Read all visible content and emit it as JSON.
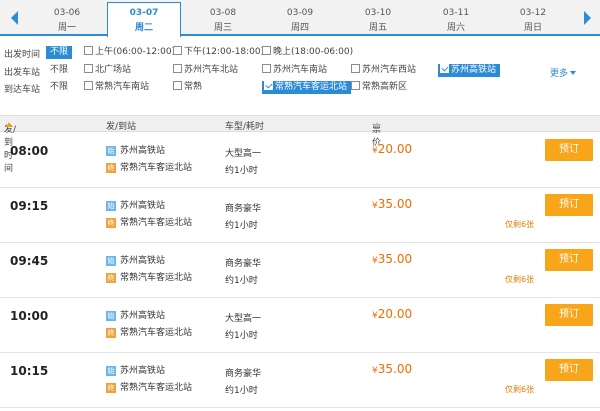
{
  "dates": [
    {
      "date": "03-06",
      "weekday": "周一",
      "active": false
    },
    {
      "date": "03-07",
      "weekday": "周二",
      "active": true
    },
    {
      "date": "03-08",
      "weekday": "周三",
      "active": false
    },
    {
      "date": "03-09",
      "weekday": "周四",
      "active": false
    },
    {
      "date": "03-10",
      "weekday": "周五",
      "active": false
    },
    {
      "date": "03-11",
      "weekday": "周六",
      "active": false
    },
    {
      "date": "03-12",
      "weekday": "周日",
      "active": false
    }
  ],
  "filters": {
    "depart_time": {
      "label": "出发时间",
      "no_limit": "不限",
      "options": [
        "上午(06:00-12:00)",
        "下午(12:00-18:00)",
        "晚上(18:00-06:00)"
      ]
    },
    "depart_station": {
      "label": "出发车站",
      "no_limit": "不限",
      "options": [
        "北广场站",
        "苏州汽车北站",
        "苏州汽车南站",
        "苏州汽车西站",
        "苏州高铁站"
      ],
      "checked": "苏州高铁站"
    },
    "arrive_station": {
      "label": "到达车站",
      "no_limit": "不限",
      "options": [
        "常熟汽车南站",
        "常熟",
        "常熟汽车客运北站",
        "常熟高新区"
      ],
      "checked": "常熟汽车客运北站"
    },
    "more": "更多"
  },
  "table_header": {
    "time": "发/到时间",
    "stations": "发/到站",
    "vehicle": "车型/耗时",
    "price": "票价"
  },
  "icons": {
    "from": "始",
    "to": "终"
  },
  "book_label": "预订",
  "currency": "¥",
  "schedules": [
    {
      "time": "08:00",
      "from": "苏州高铁站",
      "to": "常熟汽车客运北站",
      "vehicle": "大型高一",
      "duration": "约1小时",
      "price": "20.00",
      "remain": ""
    },
    {
      "time": "09:15",
      "from": "苏州高铁站",
      "to": "常熟汽车客运北站",
      "vehicle": "商务豪华",
      "duration": "约1小时",
      "price": "35.00",
      "remain": "仅剩6张"
    },
    {
      "time": "09:45",
      "from": "苏州高铁站",
      "to": "常熟汽车客运北站",
      "vehicle": "商务豪华",
      "duration": "约1小时",
      "price": "35.00",
      "remain": "仅剩6张"
    },
    {
      "time": "10:00",
      "from": "苏州高铁站",
      "to": "常熟汽车客运北站",
      "vehicle": "大型高一",
      "duration": "约1小时",
      "price": "20.00",
      "remain": ""
    },
    {
      "time": "10:15",
      "from": "苏州高铁站",
      "to": "常熟汽车客运北站",
      "vehicle": "商务豪华",
      "duration": "约1小时",
      "price": "35.00",
      "remain": "仅剩6张"
    }
  ],
  "colors": {
    "accent": "#2b8bd6",
    "price": "#f26c00",
    "book": "#f8a51a"
  }
}
